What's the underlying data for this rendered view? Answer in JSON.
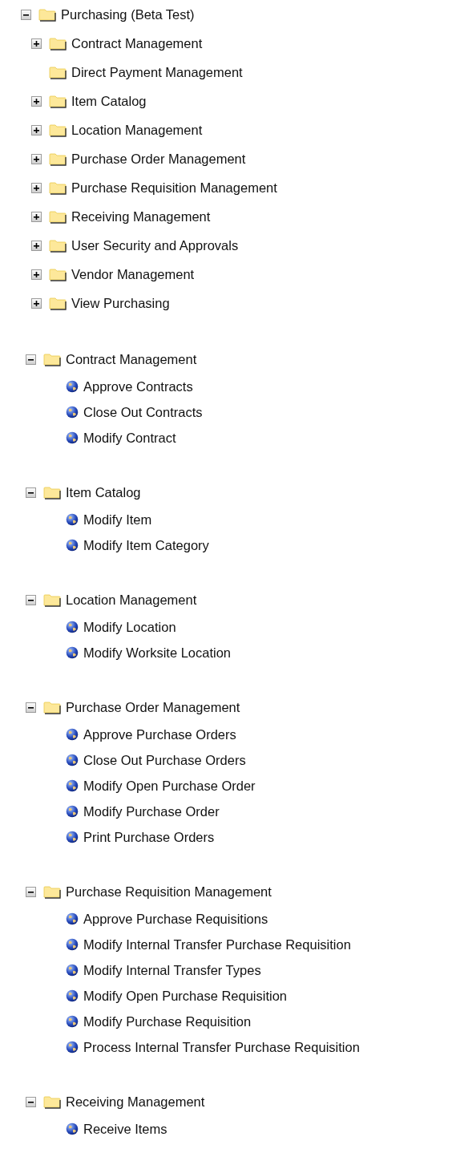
{
  "sections": [
    {
      "kind": "folder",
      "label": "Purchasing (Beta Test)",
      "expanded": true,
      "children": [
        {
          "kind": "folder",
          "label": "Contract Management",
          "expanded": false
        },
        {
          "kind": "empty-folder",
          "label": "Direct Payment Management"
        },
        {
          "kind": "folder",
          "label": "Item Catalog",
          "expanded": false
        },
        {
          "kind": "folder",
          "label": "Location Management",
          "expanded": false
        },
        {
          "kind": "folder",
          "label": "Purchase Order Management",
          "expanded": false
        },
        {
          "kind": "folder",
          "label": "Purchase Requisition Management",
          "expanded": false
        },
        {
          "kind": "folder",
          "label": "Receiving Management",
          "expanded": false
        },
        {
          "kind": "folder",
          "label": "User Security and Approvals",
          "expanded": false
        },
        {
          "kind": "folder",
          "label": "Vendor Management",
          "expanded": false
        },
        {
          "kind": "folder",
          "label": "View Purchasing",
          "expanded": false
        }
      ]
    },
    {
      "kind": "folder",
      "label": "Contract Management",
      "expanded": true,
      "children": [
        {
          "kind": "page",
          "label": "Approve Contracts"
        },
        {
          "kind": "page",
          "label": "Close Out Contracts"
        },
        {
          "kind": "page",
          "label": "Modify Contract"
        }
      ]
    },
    {
      "kind": "folder",
      "label": "Item Catalog",
      "expanded": true,
      "children": [
        {
          "kind": "page",
          "label": "Modify Item"
        },
        {
          "kind": "page",
          "label": "Modify Item Category"
        }
      ]
    },
    {
      "kind": "folder",
      "label": "Location Management",
      "expanded": true,
      "children": [
        {
          "kind": "page",
          "label": "Modify Location"
        },
        {
          "kind": "page",
          "label": "Modify Worksite Location"
        }
      ]
    },
    {
      "kind": "folder",
      "label": "Purchase Order Management",
      "expanded": true,
      "children": [
        {
          "kind": "page",
          "label": "Approve Purchase Orders"
        },
        {
          "kind": "page",
          "label": "Close Out Purchase Orders"
        },
        {
          "kind": "page",
          "label": "Modify Open Purchase Order"
        },
        {
          "kind": "page",
          "label": "Modify Purchase Order"
        },
        {
          "kind": "page",
          "label": "Print Purchase Orders"
        }
      ]
    },
    {
      "kind": "folder",
      "label": "Purchase Requisition Management",
      "expanded": true,
      "children": [
        {
          "kind": "page",
          "label": "Approve Purchase Requisitions"
        },
        {
          "kind": "page",
          "label": "Modify Internal Transfer Purchase Requisition"
        },
        {
          "kind": "page",
          "label": "Modify Internal Transfer Types"
        },
        {
          "kind": "page",
          "label": "Modify Open Purchase Requisition"
        },
        {
          "kind": "page",
          "label": "Modify Purchase Requisition"
        },
        {
          "kind": "page",
          "label": "Process Internal Transfer Purchase Requisition"
        }
      ]
    },
    {
      "kind": "folder",
      "label": "Receiving Management",
      "expanded": true,
      "children": [
        {
          "kind": "page",
          "label": "Receive Items"
        }
      ]
    }
  ]
}
